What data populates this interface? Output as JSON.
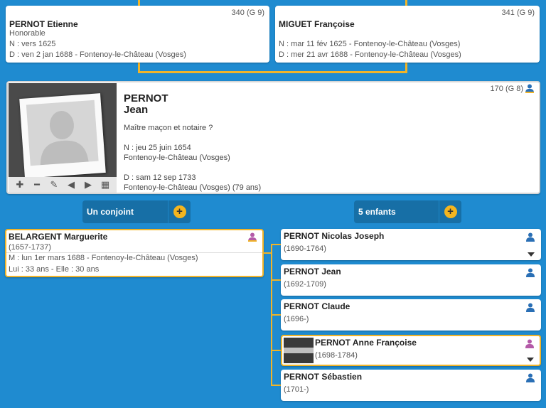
{
  "parents": {
    "father": {
      "number": "340 (G 9)",
      "name": "PERNOT Etienne",
      "title": "Honorable",
      "birth": "N : vers 1625",
      "death": "D : ven 2 jan 1688 - Fontenoy-le-Château (Vosges)"
    },
    "mother": {
      "number": "341 (G 9)",
      "name": "MIGUET Françoise",
      "birth": "N : mar 11 fév 1625 - Fontenoy-le-Château (Vosges)",
      "death": "D : mer 21 avr 1688 - Fontenoy-le-Château (Vosges)"
    }
  },
  "main": {
    "number": "170 (G 8)",
    "surname": "PERNOT",
    "given": "Jean",
    "occupation": "Maître maçon et notaire ?",
    "birth_date": "N : jeu 25 juin 1654",
    "birth_place": "Fontenoy-le-Château (Vosges)",
    "death_date": "D : sam 12 sep 1733",
    "death_place": "Fontenoy-le-Château (Vosges) (79 ans)",
    "photo_tools": {
      "add": "✚",
      "remove": "━",
      "edit": "✎",
      "prev": "◀",
      "next": "▶",
      "film": "▦"
    }
  },
  "spouse_button": {
    "label": "Un conjoint",
    "plus": "+"
  },
  "children_button": {
    "label": "5 enfants",
    "plus": "+"
  },
  "spouse": {
    "name": "BELARGENT Marguerite",
    "years": "(1657-1737)",
    "marriage": "M : lun 1er mars 1688 - Fontenoy-le-Château (Vosges)",
    "ages": "Lui : 33 ans - Elle : 30 ans"
  },
  "children": [
    {
      "name": "PERNOT Nicolas Joseph",
      "years": "(1690-1764)",
      "sex": "male"
    },
    {
      "name": "PERNOT Jean",
      "years": "(1692-1709)",
      "sex": "male"
    },
    {
      "name": "PERNOT Claude",
      "years": "(1696-)",
      "sex": "male"
    },
    {
      "name": "PERNOT Anne Françoise",
      "years": "(1698-1784)",
      "sex": "female"
    },
    {
      "name": "PERNOT Sébastien",
      "years": "(1701-)",
      "sex": "male"
    }
  ],
  "colors": {
    "background": "#1f8bd0",
    "connector": "#f0b429",
    "button": "#176fa6",
    "plus": "#f4b51f",
    "male_icon": "#2a6fb5",
    "female_icon": "#b45aa8"
  }
}
